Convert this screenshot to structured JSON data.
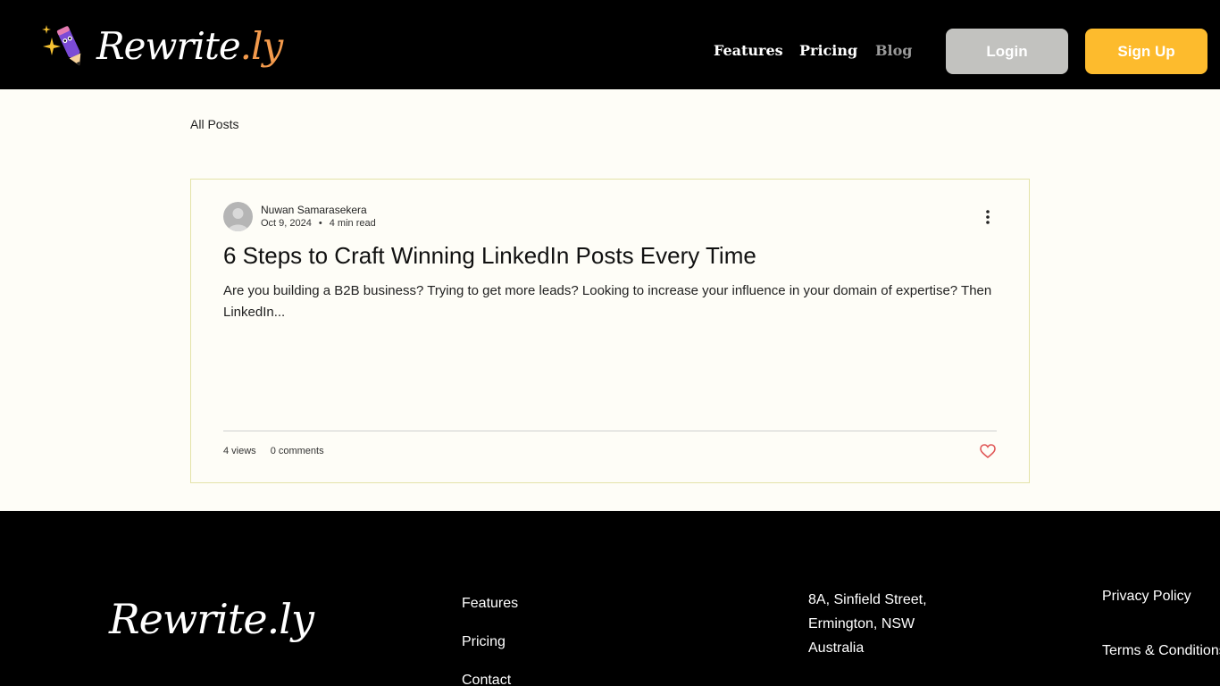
{
  "header": {
    "logo": {
      "text_main": "Rewrite",
      "text_accent": ".ly"
    },
    "nav": [
      {
        "label": "Features",
        "active": false
      },
      {
        "label": "Pricing",
        "active": false
      },
      {
        "label": "Blog",
        "active": true
      }
    ],
    "login_label": "Login",
    "signup_label": "Sign Up"
  },
  "content": {
    "all_posts_label": "All Posts",
    "post": {
      "author": "Nuwan Samarasekera",
      "date": "Oct 9, 2024",
      "separator": "•",
      "read_time": "4 min read",
      "title": "6 Steps to Craft Winning LinkedIn Posts Every Time",
      "excerpt": "Are you building a B2B business? Trying to get more leads? Looking to increase your influence in your domain of expertise? Then LinkedIn...",
      "views": "4 views",
      "comments": "0 comments"
    }
  },
  "footer": {
    "logo_text": "Rewrite.ly",
    "links": [
      "Features",
      "Pricing",
      "Contact"
    ],
    "address": [
      "8A, Sinfield Street,",
      "Ermington, NSW",
      "Australia"
    ],
    "legal": [
      "Privacy Policy",
      "Terms & Conditions"
    ]
  },
  "colors": {
    "header_bg": "#000000",
    "page_bg": "#fefdf7",
    "signup_button": "#fdbb2d",
    "login_button": "#c2c2bf",
    "logo_accent": "#f39a4c",
    "like_heart": "#e05656"
  },
  "icons": [
    "sparkle-pencil-logo-icon",
    "avatar-icon",
    "more-options-icon",
    "heart-icon"
  ]
}
